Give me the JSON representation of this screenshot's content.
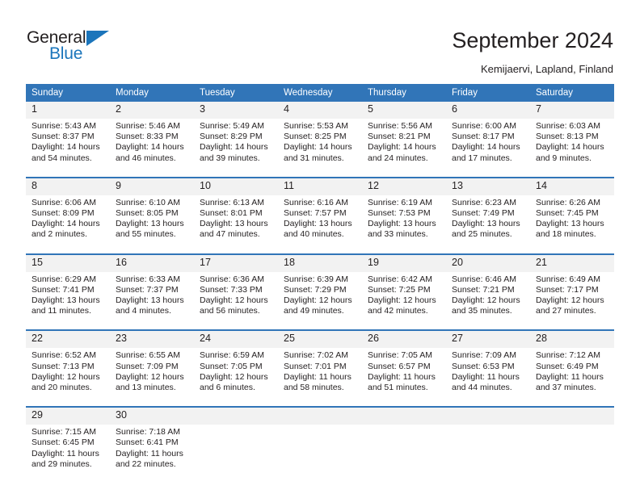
{
  "brand": {
    "name_part1": "General",
    "name_part2": "Blue",
    "triangle_icon": "triangle-icon",
    "color_dark": "#231f20",
    "color_blue": "#1b75bb"
  },
  "header": {
    "title": "September 2024",
    "subtitle": "Kemijaervi, Lapland, Finland"
  },
  "theme": {
    "header_blue": "#3175b8",
    "daynum_gray": "#f2f2f2",
    "text": "#231f20"
  },
  "weekdays": [
    "Sunday",
    "Monday",
    "Tuesday",
    "Wednesday",
    "Thursday",
    "Friday",
    "Saturday"
  ],
  "weeks": [
    {
      "days": [
        {
          "num": "1",
          "sunrise": "Sunrise: 5:43 AM",
          "sunset": "Sunset: 8:37 PM",
          "daylight1": "Daylight: 14 hours",
          "daylight2": "and 54 minutes."
        },
        {
          "num": "2",
          "sunrise": "Sunrise: 5:46 AM",
          "sunset": "Sunset: 8:33 PM",
          "daylight1": "Daylight: 14 hours",
          "daylight2": "and 46 minutes."
        },
        {
          "num": "3",
          "sunrise": "Sunrise: 5:49 AM",
          "sunset": "Sunset: 8:29 PM",
          "daylight1": "Daylight: 14 hours",
          "daylight2": "and 39 minutes."
        },
        {
          "num": "4",
          "sunrise": "Sunrise: 5:53 AM",
          "sunset": "Sunset: 8:25 PM",
          "daylight1": "Daylight: 14 hours",
          "daylight2": "and 31 minutes."
        },
        {
          "num": "5",
          "sunrise": "Sunrise: 5:56 AM",
          "sunset": "Sunset: 8:21 PM",
          "daylight1": "Daylight: 14 hours",
          "daylight2": "and 24 minutes."
        },
        {
          "num": "6",
          "sunrise": "Sunrise: 6:00 AM",
          "sunset": "Sunset: 8:17 PM",
          "daylight1": "Daylight: 14 hours",
          "daylight2": "and 17 minutes."
        },
        {
          "num": "7",
          "sunrise": "Sunrise: 6:03 AM",
          "sunset": "Sunset: 8:13 PM",
          "daylight1": "Daylight: 14 hours",
          "daylight2": "and 9 minutes."
        }
      ]
    },
    {
      "days": [
        {
          "num": "8",
          "sunrise": "Sunrise: 6:06 AM",
          "sunset": "Sunset: 8:09 PM",
          "daylight1": "Daylight: 14 hours",
          "daylight2": "and 2 minutes."
        },
        {
          "num": "9",
          "sunrise": "Sunrise: 6:10 AM",
          "sunset": "Sunset: 8:05 PM",
          "daylight1": "Daylight: 13 hours",
          "daylight2": "and 55 minutes."
        },
        {
          "num": "10",
          "sunrise": "Sunrise: 6:13 AM",
          "sunset": "Sunset: 8:01 PM",
          "daylight1": "Daylight: 13 hours",
          "daylight2": "and 47 minutes."
        },
        {
          "num": "11",
          "sunrise": "Sunrise: 6:16 AM",
          "sunset": "Sunset: 7:57 PM",
          "daylight1": "Daylight: 13 hours",
          "daylight2": "and 40 minutes."
        },
        {
          "num": "12",
          "sunrise": "Sunrise: 6:19 AM",
          "sunset": "Sunset: 7:53 PM",
          "daylight1": "Daylight: 13 hours",
          "daylight2": "and 33 minutes."
        },
        {
          "num": "13",
          "sunrise": "Sunrise: 6:23 AM",
          "sunset": "Sunset: 7:49 PM",
          "daylight1": "Daylight: 13 hours",
          "daylight2": "and 25 minutes."
        },
        {
          "num": "14",
          "sunrise": "Sunrise: 6:26 AM",
          "sunset": "Sunset: 7:45 PM",
          "daylight1": "Daylight: 13 hours",
          "daylight2": "and 18 minutes."
        }
      ]
    },
    {
      "days": [
        {
          "num": "15",
          "sunrise": "Sunrise: 6:29 AM",
          "sunset": "Sunset: 7:41 PM",
          "daylight1": "Daylight: 13 hours",
          "daylight2": "and 11 minutes."
        },
        {
          "num": "16",
          "sunrise": "Sunrise: 6:33 AM",
          "sunset": "Sunset: 7:37 PM",
          "daylight1": "Daylight: 13 hours",
          "daylight2": "and 4 minutes."
        },
        {
          "num": "17",
          "sunrise": "Sunrise: 6:36 AM",
          "sunset": "Sunset: 7:33 PM",
          "daylight1": "Daylight: 12 hours",
          "daylight2": "and 56 minutes."
        },
        {
          "num": "18",
          "sunrise": "Sunrise: 6:39 AM",
          "sunset": "Sunset: 7:29 PM",
          "daylight1": "Daylight: 12 hours",
          "daylight2": "and 49 minutes."
        },
        {
          "num": "19",
          "sunrise": "Sunrise: 6:42 AM",
          "sunset": "Sunset: 7:25 PM",
          "daylight1": "Daylight: 12 hours",
          "daylight2": "and 42 minutes."
        },
        {
          "num": "20",
          "sunrise": "Sunrise: 6:46 AM",
          "sunset": "Sunset: 7:21 PM",
          "daylight1": "Daylight: 12 hours",
          "daylight2": "and 35 minutes."
        },
        {
          "num": "21",
          "sunrise": "Sunrise: 6:49 AM",
          "sunset": "Sunset: 7:17 PM",
          "daylight1": "Daylight: 12 hours",
          "daylight2": "and 27 minutes."
        }
      ]
    },
    {
      "days": [
        {
          "num": "22",
          "sunrise": "Sunrise: 6:52 AM",
          "sunset": "Sunset: 7:13 PM",
          "daylight1": "Daylight: 12 hours",
          "daylight2": "and 20 minutes."
        },
        {
          "num": "23",
          "sunrise": "Sunrise: 6:55 AM",
          "sunset": "Sunset: 7:09 PM",
          "daylight1": "Daylight: 12 hours",
          "daylight2": "and 13 minutes."
        },
        {
          "num": "24",
          "sunrise": "Sunrise: 6:59 AM",
          "sunset": "Sunset: 7:05 PM",
          "daylight1": "Daylight: 12 hours",
          "daylight2": "and 6 minutes."
        },
        {
          "num": "25",
          "sunrise": "Sunrise: 7:02 AM",
          "sunset": "Sunset: 7:01 PM",
          "daylight1": "Daylight: 11 hours",
          "daylight2": "and 58 minutes."
        },
        {
          "num": "26",
          "sunrise": "Sunrise: 7:05 AM",
          "sunset": "Sunset: 6:57 PM",
          "daylight1": "Daylight: 11 hours",
          "daylight2": "and 51 minutes."
        },
        {
          "num": "27",
          "sunrise": "Sunrise: 7:09 AM",
          "sunset": "Sunset: 6:53 PM",
          "daylight1": "Daylight: 11 hours",
          "daylight2": "and 44 minutes."
        },
        {
          "num": "28",
          "sunrise": "Sunrise: 7:12 AM",
          "sunset": "Sunset: 6:49 PM",
          "daylight1": "Daylight: 11 hours",
          "daylight2": "and 37 minutes."
        }
      ]
    },
    {
      "days": [
        {
          "num": "29",
          "sunrise": "Sunrise: 7:15 AM",
          "sunset": "Sunset: 6:45 PM",
          "daylight1": "Daylight: 11 hours",
          "daylight2": "and 29 minutes."
        },
        {
          "num": "30",
          "sunrise": "Sunrise: 7:18 AM",
          "sunset": "Sunset: 6:41 PM",
          "daylight1": "Daylight: 11 hours",
          "daylight2": "and 22 minutes."
        },
        {
          "num": "",
          "sunrise": "",
          "sunset": "",
          "daylight1": "",
          "daylight2": ""
        },
        {
          "num": "",
          "sunrise": "",
          "sunset": "",
          "daylight1": "",
          "daylight2": ""
        },
        {
          "num": "",
          "sunrise": "",
          "sunset": "",
          "daylight1": "",
          "daylight2": ""
        },
        {
          "num": "",
          "sunrise": "",
          "sunset": "",
          "daylight1": "",
          "daylight2": ""
        },
        {
          "num": "",
          "sunrise": "",
          "sunset": "",
          "daylight1": "",
          "daylight2": ""
        }
      ]
    }
  ]
}
